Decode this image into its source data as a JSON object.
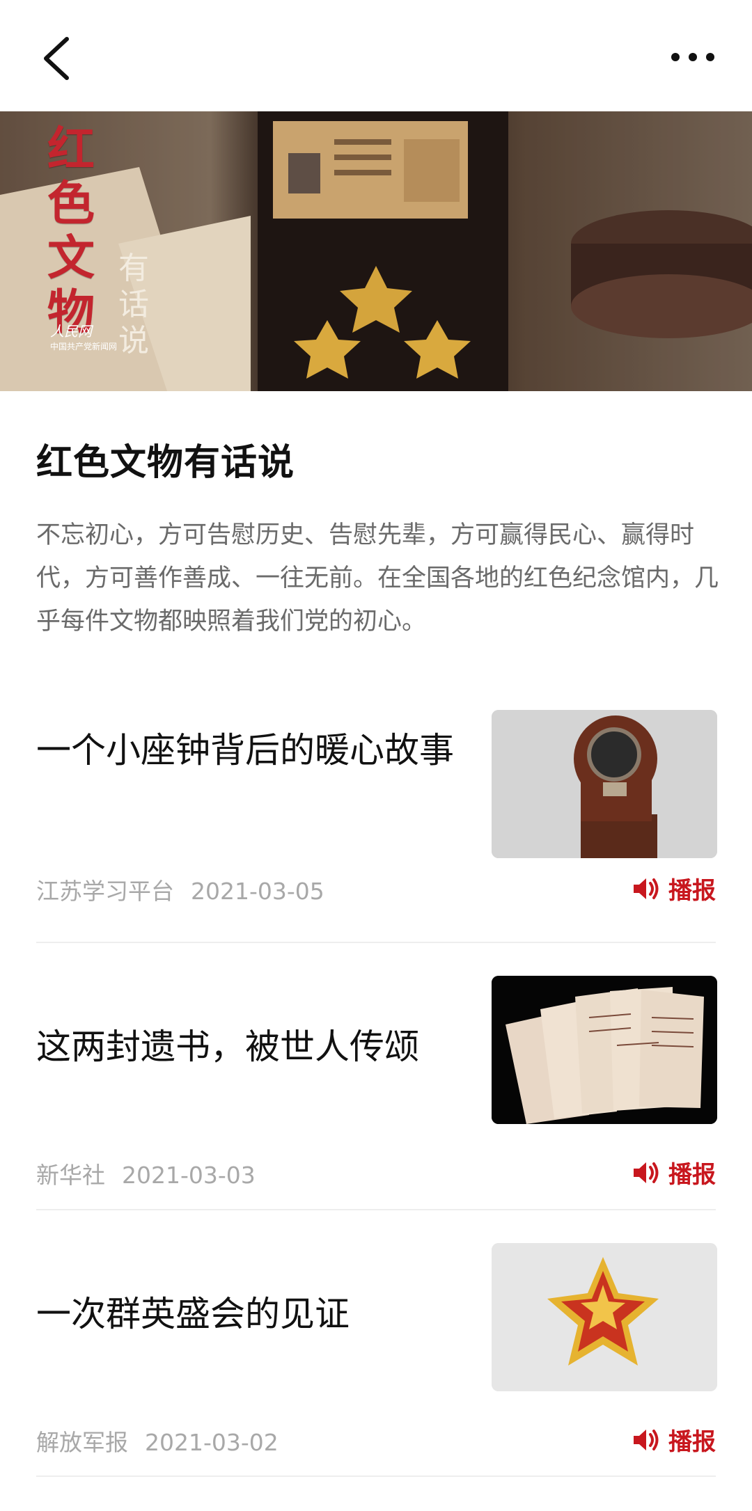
{
  "nav": {
    "back_icon": "chevron-left-icon",
    "more_icon": "more-dots-icon"
  },
  "hero": {
    "brand_text": "红色文物",
    "brand_suffix": "有话说",
    "publisher": "人民网",
    "publisher_sub": "中国共产党新闻网"
  },
  "section": {
    "title": "红色文物有话说",
    "intro": "不忘初心，方可告慰历史、告慰先辈，方可赢得民心、赢得时代，方可善作善成、一往无前。在全国各地的红色纪念馆内，几乎每件文物都映照着我们党的初心。"
  },
  "articles": [
    {
      "title": "一个小座钟背后的暖心故事",
      "source": "江苏学习平台",
      "date": "2021-03-05",
      "play_label": "播报",
      "thumb": "desk-clock"
    },
    {
      "title": "这两封遗书，被世人传颂",
      "source": "新华社",
      "date": "2021-03-03",
      "play_label": "播报",
      "thumb": "letters"
    },
    {
      "title": "一次群英盛会的见证",
      "source": "解放军报",
      "date": "2021-03-02",
      "play_label": "播报",
      "thumb": "medal"
    }
  ],
  "colors": {
    "accent": "#c8171e",
    "title": "#111111",
    "meta": "#a8a8a8"
  }
}
